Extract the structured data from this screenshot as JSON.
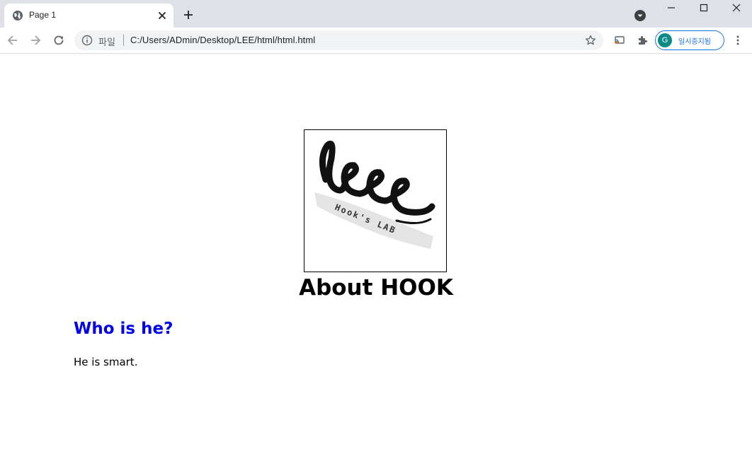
{
  "browser": {
    "tab": {
      "title": "Page 1"
    },
    "address": {
      "scheme_label": "파일",
      "url": "C:/Users/ADmin/Desktop/LEE/html/html.html"
    },
    "profile": {
      "initial": "G",
      "label": "일시중지됨"
    }
  },
  "page": {
    "logo": {
      "text": "leee",
      "subtext": "Hook's LAB"
    },
    "heading": "About HOOK",
    "subheading": "Who is he?",
    "paragraph": "He is smart."
  },
  "icons": [
    "globe-icon",
    "close-icon",
    "plus-icon",
    "dropdown-icon",
    "minimize-icon",
    "maximize-icon",
    "window-close-icon",
    "back-arrow-icon",
    "forward-arrow-icon",
    "reload-icon",
    "info-icon",
    "star-icon",
    "cast-icon",
    "puzzle-icon",
    "kebab-menu-icon"
  ],
  "colors": {
    "heading2": "#0000ee",
    "profile_accent": "#1a73e8",
    "avatar": "#0b8a8a",
    "tabstrip": "#dee1e6"
  }
}
